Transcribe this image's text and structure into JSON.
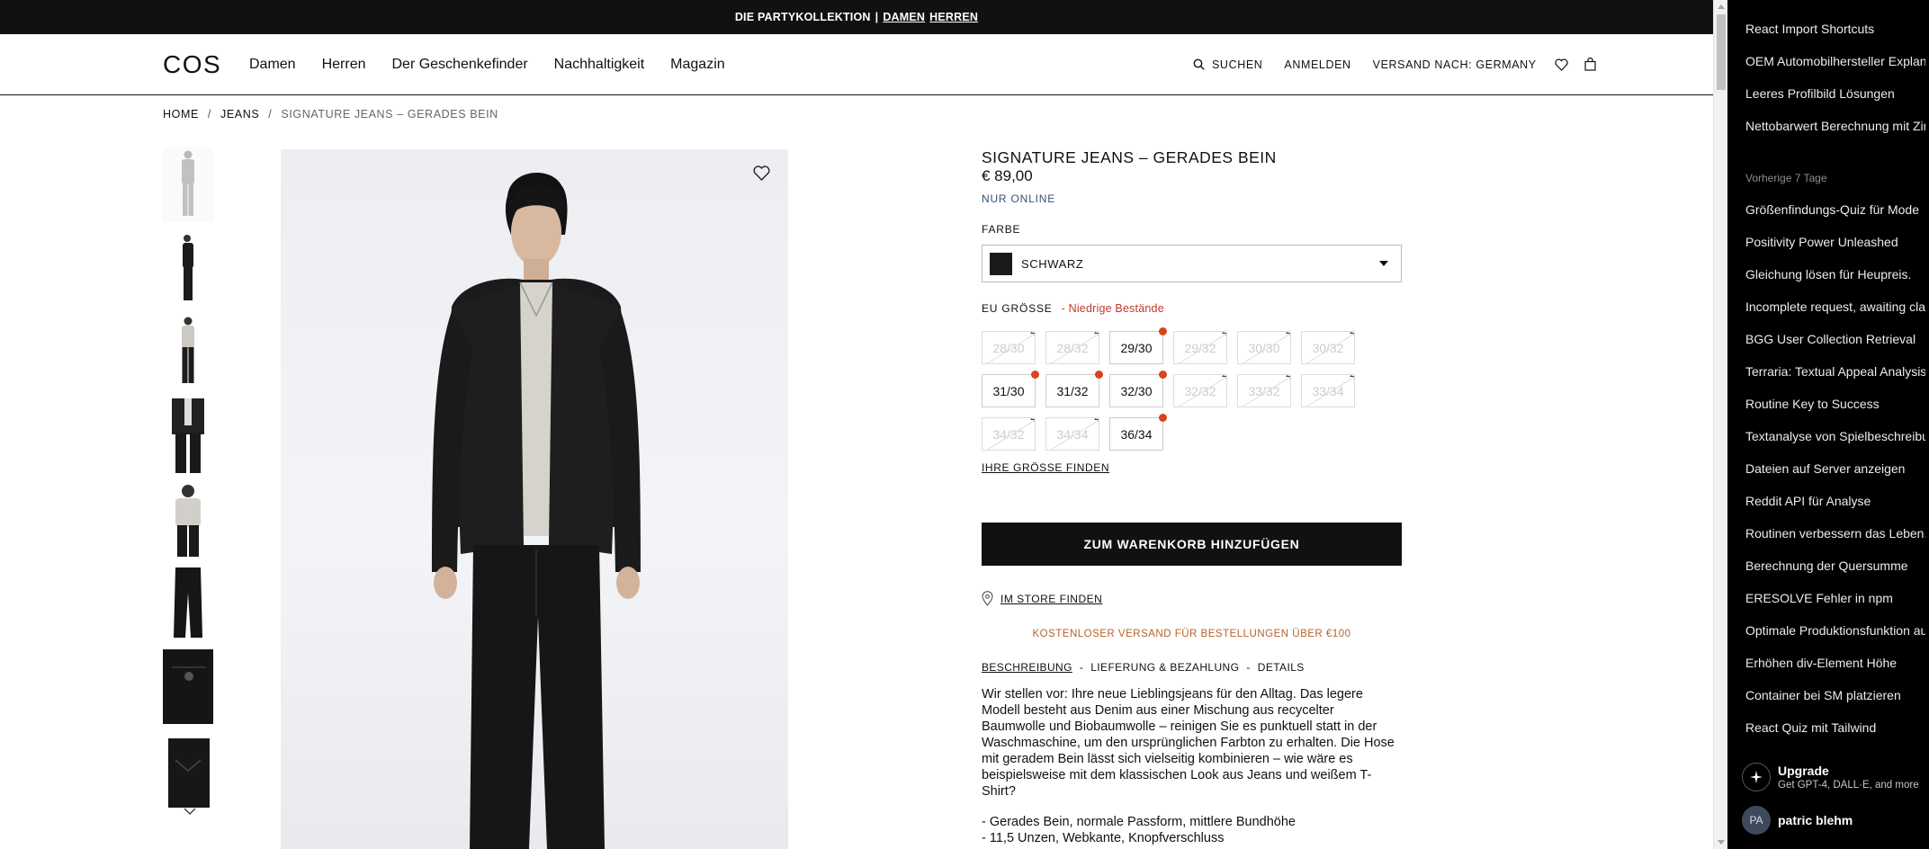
{
  "promo": {
    "text": "DIE PARTYKOLLEKTION",
    "sep": "|",
    "link1": "DAMEN",
    "link2": "HERREN"
  },
  "header": {
    "logo": "COS",
    "nav": [
      "Damen",
      "Herren",
      "Der Geschenkefinder",
      "Nachhaltigkeit",
      "Magazin"
    ],
    "search": "SUCHEN",
    "login": "ANMELDEN",
    "shipping": "VERSAND NACH: GERMANY"
  },
  "breadcrumb": {
    "home": "HOME",
    "sep": "/",
    "cat": "JEANS",
    "current": "SIGNATURE JEANS – GERADES BEIN"
  },
  "product": {
    "name": "SIGNATURE JEANS – GERADES BEIN",
    "price": "€ 89,00",
    "online": "NUR ONLINE",
    "color_label": "FARBE",
    "color_value": "SCHWARZ",
    "color_hex": "#1a1a1a",
    "size_label": "EU GRÖSSE",
    "low_stock": "- Niedrige Bestände",
    "sizes": [
      {
        "label": "28/30",
        "available": false
      },
      {
        "label": "28/32",
        "available": false
      },
      {
        "label": "29/30",
        "available": true
      },
      {
        "label": "29/32",
        "available": false
      },
      {
        "label": "30/30",
        "available": false
      },
      {
        "label": "30/32",
        "available": false
      },
      {
        "label": "31/30",
        "available": true
      },
      {
        "label": "31/32",
        "available": true
      },
      {
        "label": "32/30",
        "available": true
      },
      {
        "label": "32/32",
        "available": false
      },
      {
        "label": "33/32",
        "available": false
      },
      {
        "label": "33/34",
        "available": false
      },
      {
        "label": "34/32",
        "available": false
      },
      {
        "label": "34/34",
        "available": false
      },
      {
        "label": "36/34",
        "available": true
      }
    ],
    "find_size": "IHRE GRÖSSE FINDEN",
    "add_to_cart": "ZUM WARENKORB HINZUFÜGEN",
    "find_store": "IM STORE FINDEN",
    "free_shipping": "KOSTENLOSER VERSAND FÜR BESTELLUNGEN ÜBER €100",
    "tabs": [
      "BESCHREIBUNG",
      "LIEFERUNG & BEZAHLUNG",
      "DETAILS"
    ],
    "tab_sep": "-",
    "description": "Wir stellen vor: Ihre neue Lieblingsjeans für den Alltag. Das legere Modell besteht aus Denim aus einer Mischung aus recycelter Baumwolle und Biobaumwolle – reinigen Sie es punktuell statt in der Waschmaschine, um den ursprünglichen Farbton zu erhalten. Die Hose mit geradem Bein lässt sich vielseitig kombinieren – wie wäre es beispielsweise mit dem klassischen Look aus Jeans und weißem T-Shirt?",
    "bullets": [
      "- Gerades Bein, normale Passform, mittlere Bundhöhe",
      "- 11,5 Unzen, Webkante, Knopfverschluss"
    ]
  },
  "sidebar": {
    "items_top": [
      "React Import Shortcuts",
      "OEM Automobilhersteller Explanation",
      "Leeres Profilbild Lösungen",
      "Nettobarwert Berechnung mit Zins"
    ],
    "section": "Vorherige 7 Tage",
    "items": [
      "Größenfindungs-Quiz für Mode",
      "Positivity Power Unleashed",
      "Gleichung lösen für Heupreis.",
      "Incomplete request, awaiting clarification",
      "BGG User Collection Retrieval",
      "Terraria: Textual Appeal Analysis",
      "Routine Key to Success",
      "Textanalyse von Spielbeschreibungen",
      "Dateien auf Server anzeigen",
      "Reddit API für Analyse",
      "Routinen verbessern das Leben.",
      "Berechnung der Quersumme",
      "ERESOLVE Fehler in npm",
      "Optimale Produktionsfunktion auswählen",
      "Erhöhen div-Element Höhe",
      "Container bei SM platzieren",
      "React Quiz mit Tailwind"
    ],
    "upgrade_title": "Upgrade",
    "upgrade_sub": "Get GPT-4, DALL·E, and more",
    "avatar": "PA",
    "username": "patric blehm"
  }
}
